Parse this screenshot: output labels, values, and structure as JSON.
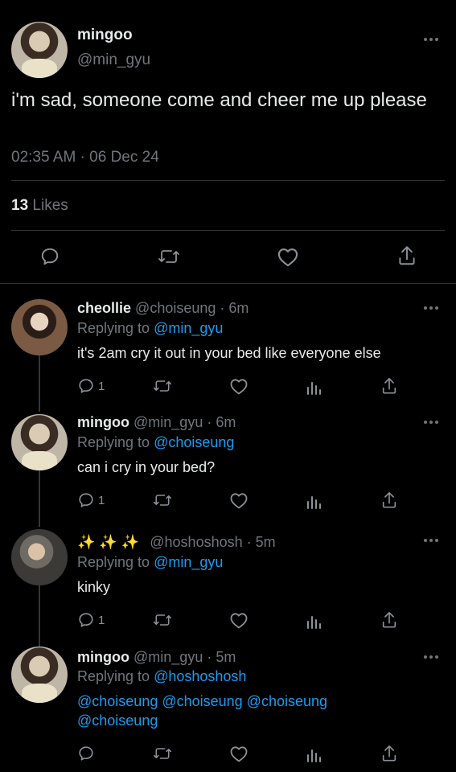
{
  "main_tweet": {
    "display_name": "mingoo",
    "handle": "@min_gyu",
    "text": "i'm sad, someone come and cheer me up please",
    "timestamp": "02:35 AM · 06 Dec 24",
    "likes_count": "13",
    "likes_label": "Likes"
  },
  "replies": [
    {
      "display_name": "cheollie",
      "handle": "@choiseung",
      "time": "· 6m",
      "replying_label": "Replying to",
      "replying_to": "@min_gyu",
      "text": "it's 2am cry it out in your bed like everyone else",
      "reply_count": "1"
    },
    {
      "display_name": "mingoo",
      "handle": "@min_gyu",
      "time": "· 6m",
      "replying_label": "Replying to",
      "replying_to": "@choiseung",
      "text": "can i cry in your bed?",
      "reply_count": "1"
    },
    {
      "display_name": "✨ ✨ ✨",
      "handle": "@hoshoshosh",
      "time": "· 5m",
      "replying_label": "Replying to",
      "replying_to": "@min_gyu",
      "text": "kinky",
      "reply_count": "1"
    },
    {
      "display_name": "mingoo",
      "handle": "@min_gyu",
      "time": "· 5m",
      "replying_label": "Replying to",
      "replying_to": "@hoshoshosh",
      "mention_line1": "@choiseung @choiseung @choiseung",
      "mention_line2": "@choiseung",
      "reply_count": ""
    }
  ],
  "icons": [
    "more-icon",
    "reply-icon",
    "retweet-icon",
    "like-icon",
    "share-icon",
    "analytics-icon"
  ],
  "colors": {
    "background": "#000000",
    "text": "#e7e9ea",
    "muted": "#71767b",
    "link": "#1d9bf0"
  }
}
